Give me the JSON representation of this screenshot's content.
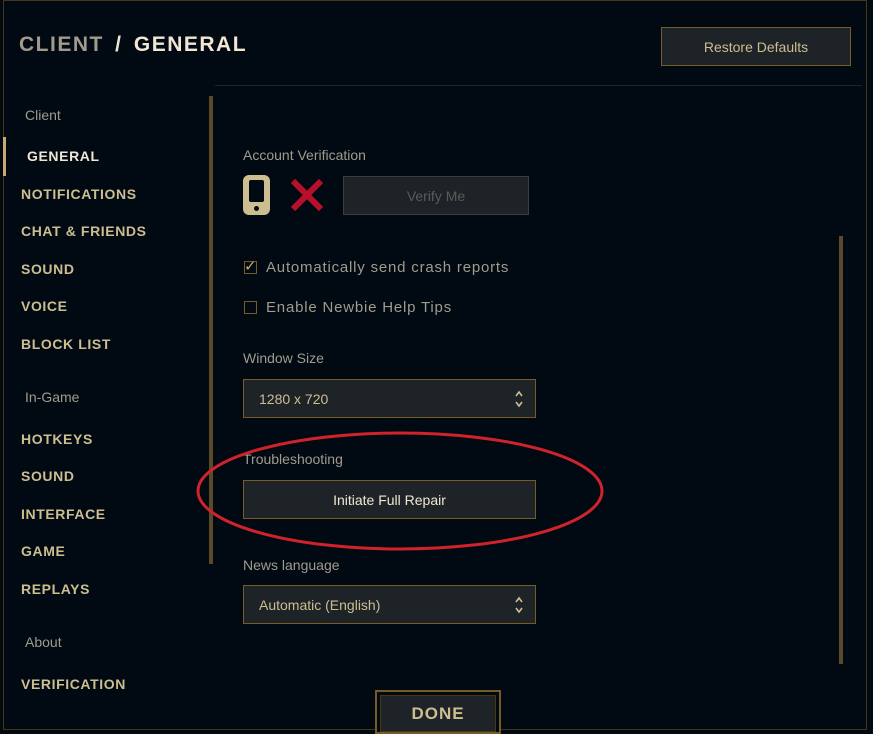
{
  "header": {
    "crumb_parent": "CLIENT",
    "separator": "/",
    "crumb_current": "GENERAL",
    "restore_label": "Restore Defaults"
  },
  "sidebar": {
    "client_heading": "Client",
    "client_items": [
      "GENERAL",
      "NOTIFICATIONS",
      "CHAT & FRIENDS",
      "SOUND",
      "VOICE",
      "BLOCK LIST"
    ],
    "ingame_heading": "In-Game",
    "ingame_items": [
      "HOTKEYS",
      "SOUND",
      "INTERFACE",
      "GAME",
      "REPLAYS"
    ],
    "about_heading": "About",
    "about_items": [
      "VERIFICATION"
    ],
    "active_item": "GENERAL"
  },
  "main": {
    "account_label": "Account Verification",
    "verify_label": "Verify Me",
    "crash_label": "Automatically send crash reports",
    "crash_checked": true,
    "newbie_label": "Enable Newbie Help Tips",
    "newbie_checked": false,
    "window_size_label": "Window Size",
    "window_size_value": "1280 x 720",
    "troubleshooting_label": "Troubleshooting",
    "repair_label": "Initiate Full Repair",
    "news_label": "News language",
    "news_value": "Automatic (English)"
  },
  "footer": {
    "done_label": "DONE"
  },
  "colors": {
    "background": "#010a13",
    "gold": "#c8aa6e",
    "text_gold": "#cdbe91",
    "annotation": "#d0222a"
  },
  "icons": [
    "phone-icon",
    "x-mark-icon",
    "checkmark-icon",
    "select-arrows-icon"
  ]
}
